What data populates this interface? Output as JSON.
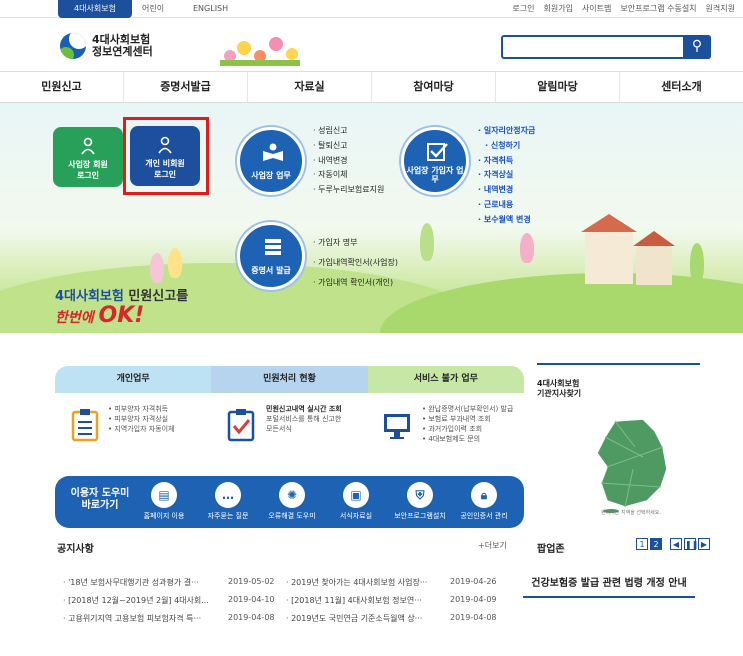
{
  "topbar": {
    "main": "4대사회보험",
    "kids": "어린이",
    "english": "ENGLISH",
    "links": [
      "로그인",
      "회원가입",
      "사이트맵",
      "보안프로그램 수동설치",
      "원격지원"
    ]
  },
  "logo": {
    "line1": "4대사회보험",
    "line2": "정보연계센터"
  },
  "search": {
    "placeholder": ""
  },
  "gnb": [
    "민원신고",
    "증명서발급",
    "자료실",
    "참여마당",
    "알림마당",
    "센터소개"
  ],
  "login": {
    "biz": [
      "사업장 회원",
      "로그인"
    ],
    "pers": [
      "개인 비회원",
      "로그인"
    ]
  },
  "biz_work": {
    "label": "사업장 업무",
    "items": [
      "성립신고",
      "탈퇴신고",
      "내역변경",
      "자동이체",
      "두루누리보험료지원"
    ]
  },
  "member_work": {
    "label": "사업장 가입자 업무",
    "items": [
      "일자리안정자금",
      "신청하기",
      "자격취득",
      "자격상실",
      "내역변경",
      "근로내용",
      "보수월액 변경"
    ]
  },
  "cert": {
    "label": "증명서 발급",
    "items": [
      "가입자 명부",
      "가입내역확인서(사업장)",
      "가입내역 확인서(개인)"
    ]
  },
  "hero_text": {
    "line1": "4대사회보험",
    "line1b": " 민원신고를",
    "line2a": "한번에 ",
    "line2b": "OK!"
  },
  "tabs": [
    "개인업무",
    "민원처리 현황",
    "서비스 불가 업무"
  ],
  "svc1": [
    "피부양자 자격취득",
    "피부양자 자격상실",
    "지역가입자 자동이체"
  ],
  "svc2": {
    "title": "민원신고내역 실시간 조회",
    "desc": [
      "포털서비스를 통해 신고한",
      "모든서식"
    ]
  },
  "svc3": [
    "완납증명서(납부확인서) 발급",
    "보험료 부과내역 조회",
    "과거가입이력 조회",
    "4대보험제도 문의"
  ],
  "help": {
    "title": "이용자 도우미 바로가기",
    "items": [
      "홈페이지 이용",
      "자주묻는 질문",
      "오류해결 도우미",
      "서식자료실",
      "보안프로그램설치",
      "공인인증서 관리"
    ]
  },
  "notice": {
    "title": "공지사항",
    "more": "+더보기",
    "rows": [
      {
        "t": "'18년 보험사무대행기관 성과평가 결···",
        "d": "2019-05-02"
      },
      {
        "t": "2019년 찾아가는 4대사회보험 사업장···",
        "d": "2019-04-26"
      },
      {
        "t": "[2018년 12월~2019년 2월] 4대사회...",
        "d": "2019-04-10"
      },
      {
        "t": "[2018년 11월] 4대사회보험 정보연···",
        "d": "2019-04-09"
      },
      {
        "t": "고용위기지역 고용보험 피보험자격 특···",
        "d": "2019-04-08"
      },
      {
        "t": "2019년도 국민연금 기준소득월액 상···",
        "d": "2019-04-08"
      }
    ]
  },
  "branch": {
    "title1": "4대사회보험",
    "title2": "기관지사찾기",
    "note": "원하시는 지역을 선택하세요."
  },
  "popup": {
    "title": "팝업존",
    "pages": [
      "1",
      "2"
    ],
    "banner": "건강보험증 발급 관련 법령 개정 안내"
  },
  "colors": {
    "brand": "#1c4f9c",
    "accent_red": "#e31b1b",
    "green": "#28a05a"
  }
}
